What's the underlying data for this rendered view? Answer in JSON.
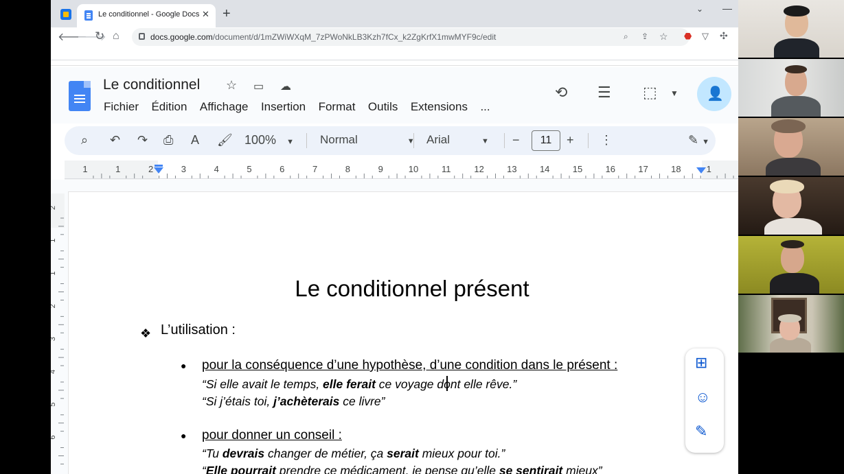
{
  "browser": {
    "tab_title": "Le conditionnel - Google Docs",
    "tab_close": "✕",
    "new_tab": "+",
    "minimize": "—",
    "tab_search": "⌄",
    "url_host": "docs.google.com",
    "url_path": "/document/d/1mZWiWXqM_7zPWoNkLB3Kzh7fCx_k2ZgKrfX1mwMYF9c/edit"
  },
  "docs": {
    "title": "Le conditionnel",
    "menu": [
      "Fichier",
      "Édition",
      "Affichage",
      "Insertion",
      "Format",
      "Outils",
      "Extensions",
      "..."
    ]
  },
  "toolbar": {
    "zoom": "100%",
    "style": "Normal",
    "font": "Arial",
    "font_size": "11",
    "minus": "−",
    "plus": "+"
  },
  "ruler": {
    "labels": [
      "1",
      "1",
      "2",
      "3",
      "4",
      "5",
      "6",
      "7",
      "8",
      "9",
      "10",
      "11",
      "12",
      "13",
      "14",
      "15",
      "16",
      "17",
      "18",
      "1"
    ],
    "vertical_labels": [
      "2",
      "1",
      "1",
      "2",
      "3",
      "4",
      "5",
      "6"
    ]
  },
  "document": {
    "heading": "Le conditionnel présent",
    "section_marker": "❖",
    "section": "L’utilisation :",
    "bullet": "●",
    "point1": "pour la conséquence d’une hypothèse, d’une condition dans le présent :",
    "ex1_a": "“Si elle avait le temps, ",
    "ex1_b": "elle ferait",
    "ex1_c": " ce voyage dont elle rêve.”",
    "ex2_a": "“Si j’étais toi, ",
    "ex2_b": "j’achèterais",
    "ex2_c": " ce livre”",
    "point2": "pour donner un conseil :",
    "ex3_a": "“Tu ",
    "ex3_b": "devrais",
    "ex3_c": " changer de métier, ça ",
    "ex3_d": "serait",
    "ex3_e": " mieux pour toi.”",
    "ex4_a": "“",
    "ex4_b": "Elle pourrait",
    "ex4_c": " prendre ce médicament, je pense qu’elle ",
    "ex4_d": "se sentirait",
    "ex4_e": " mieux”"
  },
  "colors": {
    "accent": "#0b57d0",
    "share_bg": "#c2e7ff",
    "toolbar_bg": "#edf2fa",
    "tabstrip_bg": "#dee1e6"
  }
}
